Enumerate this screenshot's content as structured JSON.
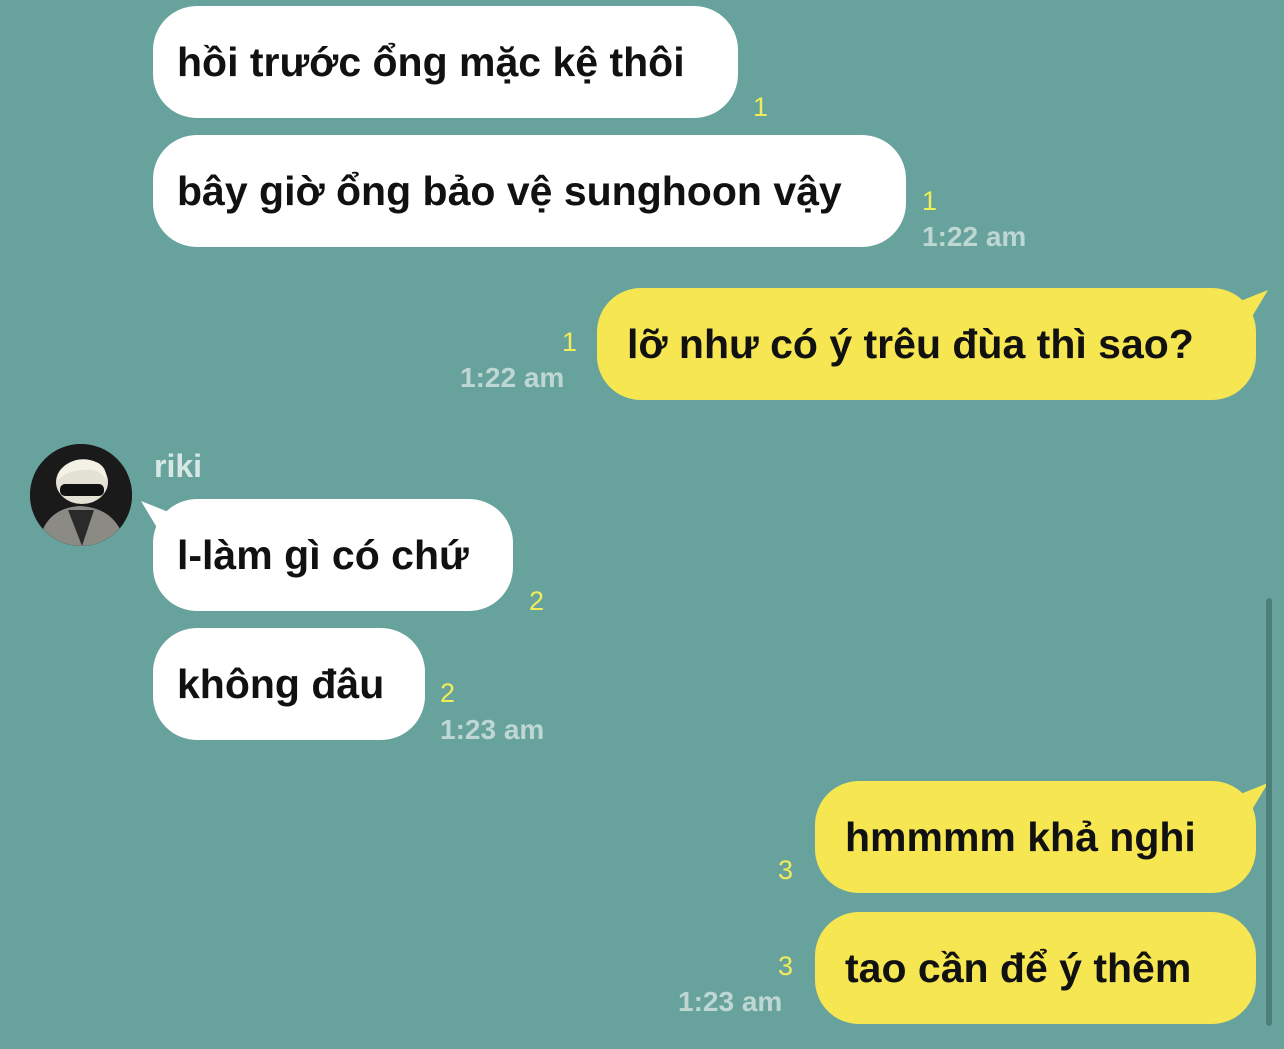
{
  "contact": {
    "name": "riki",
    "avatar_icon": "contact-avatar"
  },
  "colors": {
    "background": "#67a39c",
    "incoming_bubble": "#ffffff",
    "outgoing_bubble": "#f6e752",
    "unread_count": "#f2ec5a"
  },
  "messages": [
    {
      "direction": "incoming",
      "text": "hồi trước ổng mặc kệ thôi",
      "unread": "1",
      "time": ""
    },
    {
      "direction": "incoming",
      "text": "bây giờ ổng bảo vệ sunghoon vậy",
      "unread": "1",
      "time": "1:22 am"
    },
    {
      "direction": "outgoing",
      "text": "lỡ như có ý trêu đùa thì sao?",
      "unread": "1",
      "time": "1:22 am"
    },
    {
      "direction": "incoming",
      "text": "l-làm gì có chứ",
      "unread": "2",
      "time": ""
    },
    {
      "direction": "incoming",
      "text": "không đâu",
      "unread": "2",
      "time": "1:23 am"
    },
    {
      "direction": "outgoing",
      "text": "hmmmm khả nghi",
      "unread": "3",
      "time": ""
    },
    {
      "direction": "outgoing",
      "text": "tao cần để ý thêm",
      "unread": "3",
      "time": "1:23 am"
    }
  ]
}
